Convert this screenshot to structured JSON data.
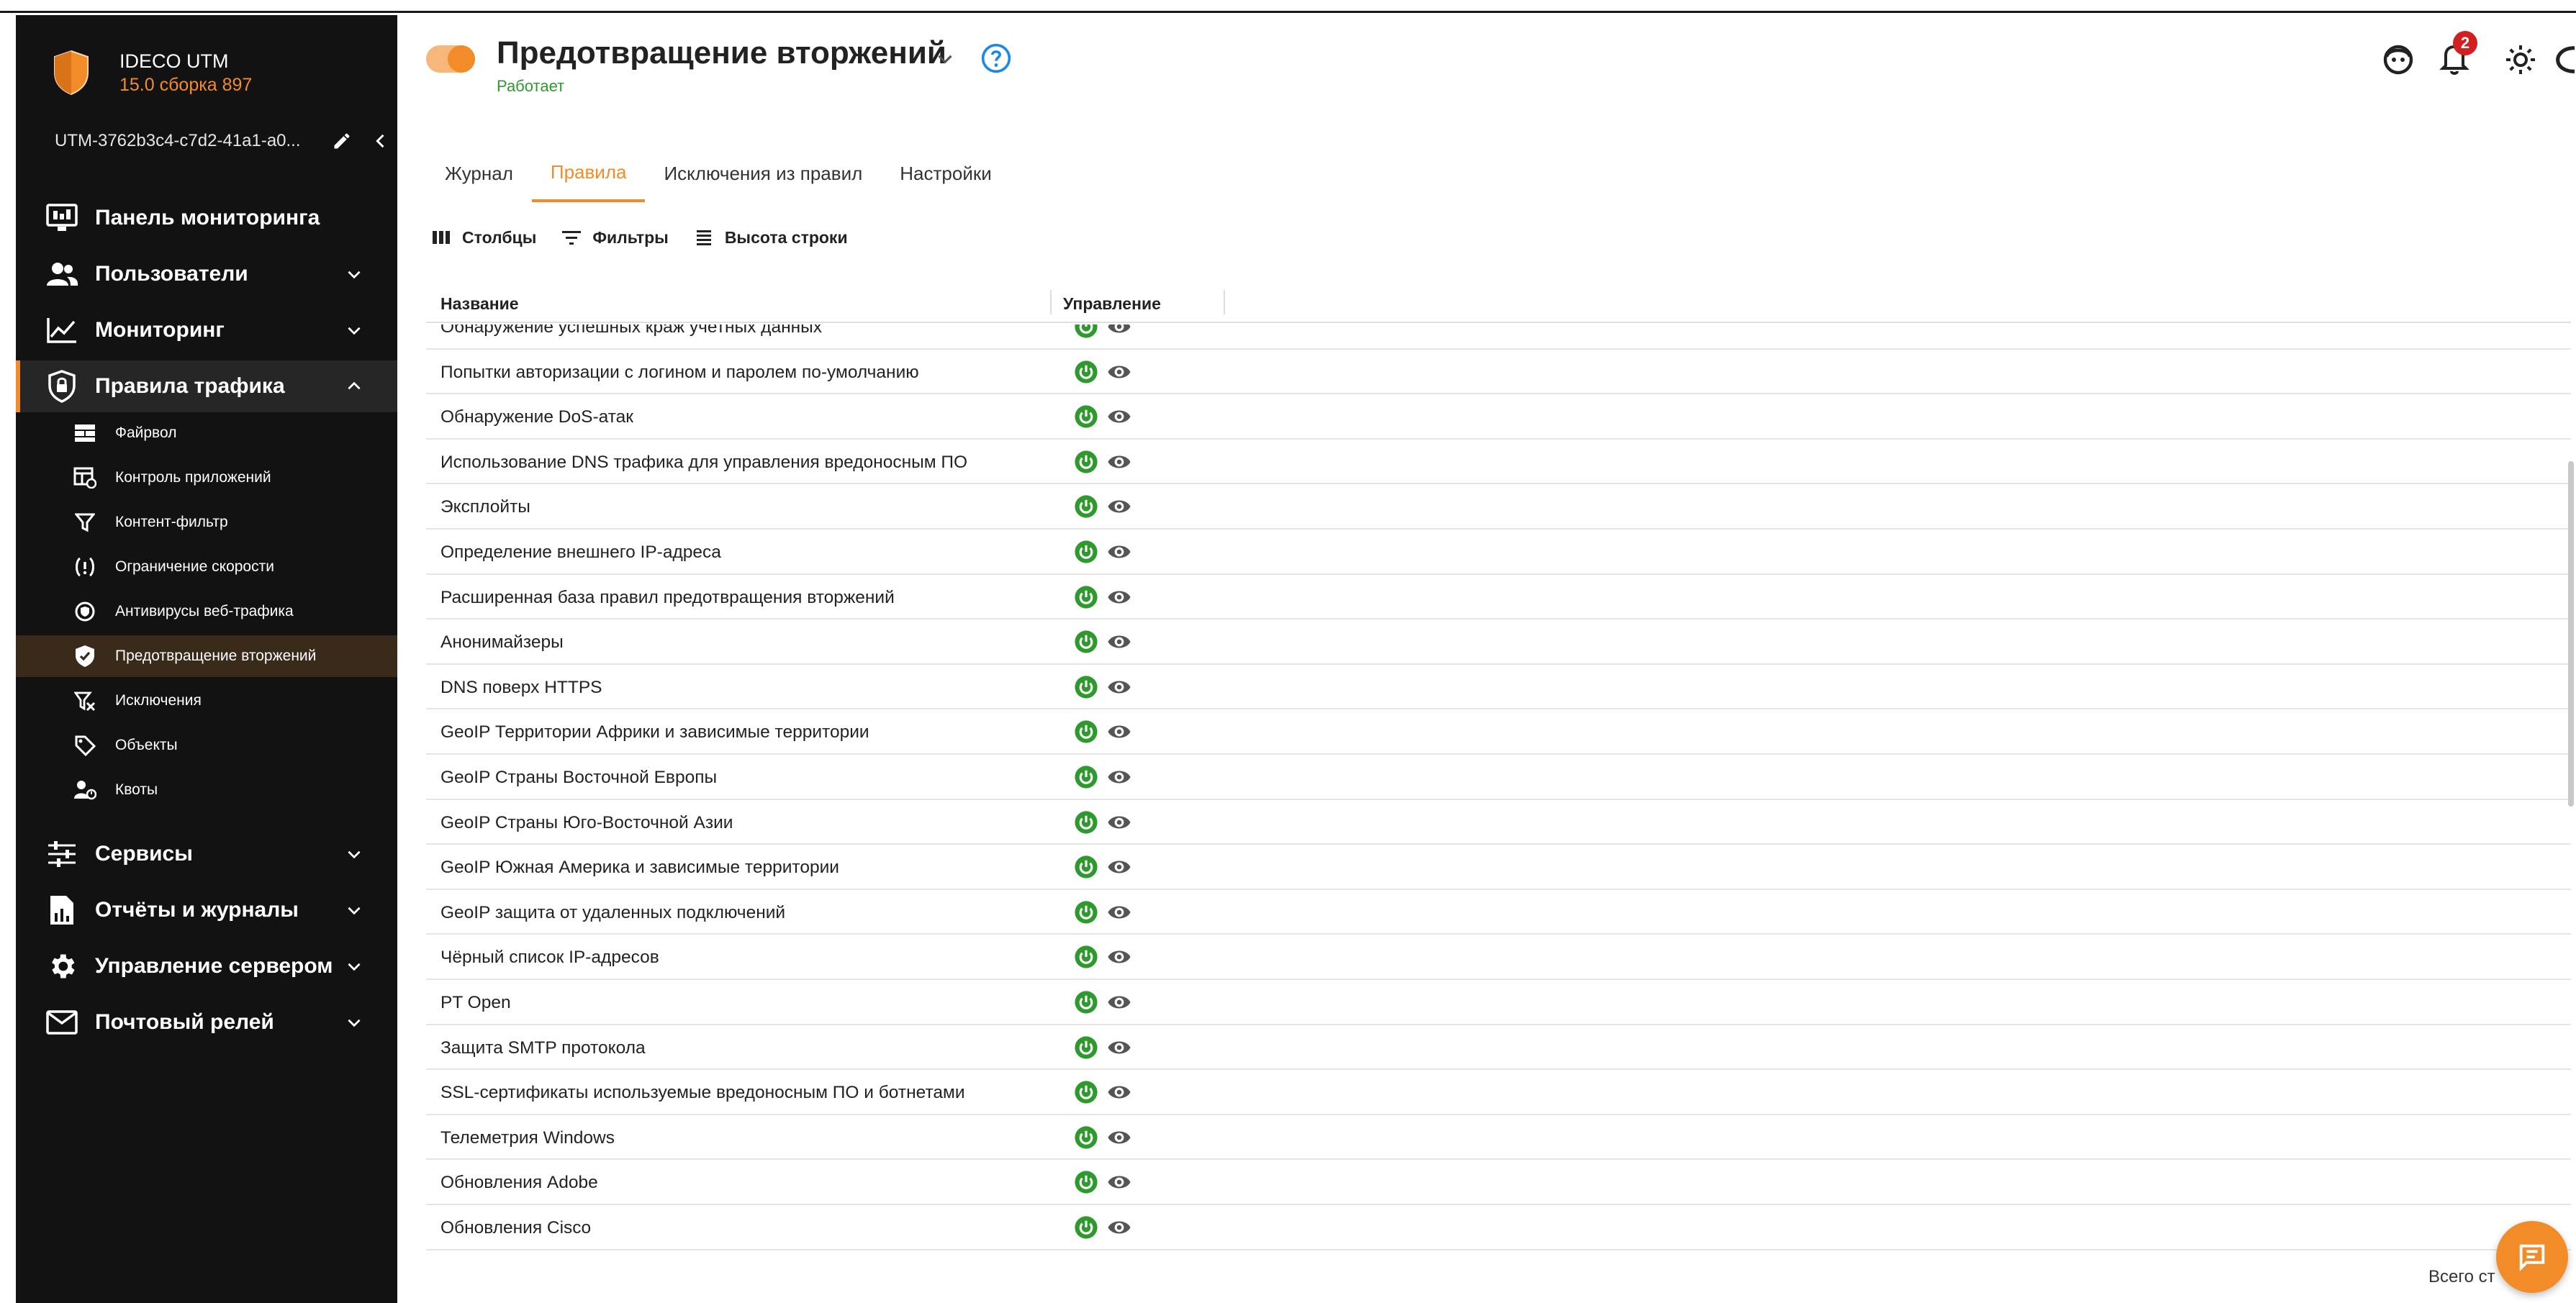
{
  "brand": {
    "name": "IDECO UTM",
    "version": "15.0 сборка 897",
    "accent_color": "#f28c28"
  },
  "server": {
    "name": "UTM-3762b3c4-c7d2-41a1-a0...",
    "edit_icon": "pencil-icon",
    "collapse_icon": "chevron-left-icon"
  },
  "sidebar": {
    "main_items": [
      {
        "label": "Панель мониторинга",
        "icon": "monitor-dashboard-icon"
      },
      {
        "label": "Пользователи",
        "icon": "users-icon"
      },
      {
        "label": "Мониторинг",
        "icon": "chart-line-icon"
      },
      {
        "label": "Правила трафика",
        "icon": "shield-lock-icon"
      },
      {
        "label": "Сервисы",
        "icon": "sliders-icon"
      },
      {
        "label": "Отчёты и журналы",
        "icon": "report-icon"
      },
      {
        "label": "Управление сервером",
        "icon": "gear-icon"
      },
      {
        "label": "Почтовый релей",
        "icon": "mail-icon"
      }
    ],
    "sub_items": [
      {
        "label": "Файрвол",
        "icon": "firewall-icon"
      },
      {
        "label": "Контроль приложений",
        "icon": "app-control-icon"
      },
      {
        "label": "Контент-фильтр",
        "icon": "filter-icon"
      },
      {
        "label": "Ограничение скорости",
        "icon": "speed-limit-icon"
      },
      {
        "label": "Антивирусы веб-трафика",
        "icon": "antivirus-icon"
      },
      {
        "label": "Предотвращение вторжений",
        "icon": "shield-check-icon"
      },
      {
        "label": "Исключения",
        "icon": "exclusion-filter-icon"
      },
      {
        "label": "Объекты",
        "icon": "tag-icon"
      },
      {
        "label": "Квоты",
        "icon": "quota-icon"
      }
    ]
  },
  "header": {
    "title": "Предотвращение вторжений",
    "status": "Работает",
    "notification_count": "2",
    "status_color": "#2e9a2e"
  },
  "tabs": [
    {
      "label": "Журнал"
    },
    {
      "label": "Правила"
    },
    {
      "label": "Исключения из правил"
    },
    {
      "label": "Настройки"
    }
  ],
  "toolbar": {
    "columns_label": "Столбцы",
    "filters_label": "Фильтры",
    "row_height_label": "Высота строки"
  },
  "table": {
    "headers": {
      "name": "Название",
      "control": "Управление"
    },
    "rows": [
      {
        "name": "Обнаружение успешных краж учетных данных"
      },
      {
        "name": "Попытки авторизации с логином и паролем по-умолчанию"
      },
      {
        "name": "Обнаружение DoS-атак"
      },
      {
        "name": "Использование DNS трафика для управления вредоносным ПО"
      },
      {
        "name": "Эксплойты"
      },
      {
        "name": "Определение внешнего IP-адреса"
      },
      {
        "name": "Расширенная база правил предотвращения вторжений"
      },
      {
        "name": "Анонимайзеры"
      },
      {
        "name": "DNS поверх HTTPS"
      },
      {
        "name": "GeoIP Территории Африки и зависимые территории"
      },
      {
        "name": "GeoIP Страны Восточной Европы"
      },
      {
        "name": "GeoIP Страны Юго-Восточной Азии"
      },
      {
        "name": "GeoIP Южная Америка и зависимые территории"
      },
      {
        "name": "GeoIP защита от удаленных подключений"
      },
      {
        "name": "Чёрный список IP-адресов"
      },
      {
        "name": "PT Open"
      },
      {
        "name": "Защита SMTP протокола"
      },
      {
        "name": "SSL-сертификаты используемые вредоносным ПО и ботнетами"
      },
      {
        "name": "Телеметрия Windows"
      },
      {
        "name": "Обновления Adobe"
      },
      {
        "name": "Обновления Cisco"
      }
    ],
    "enabled_color": "#2e9a2e"
  },
  "footer": {
    "total_text": "Всего ст"
  }
}
